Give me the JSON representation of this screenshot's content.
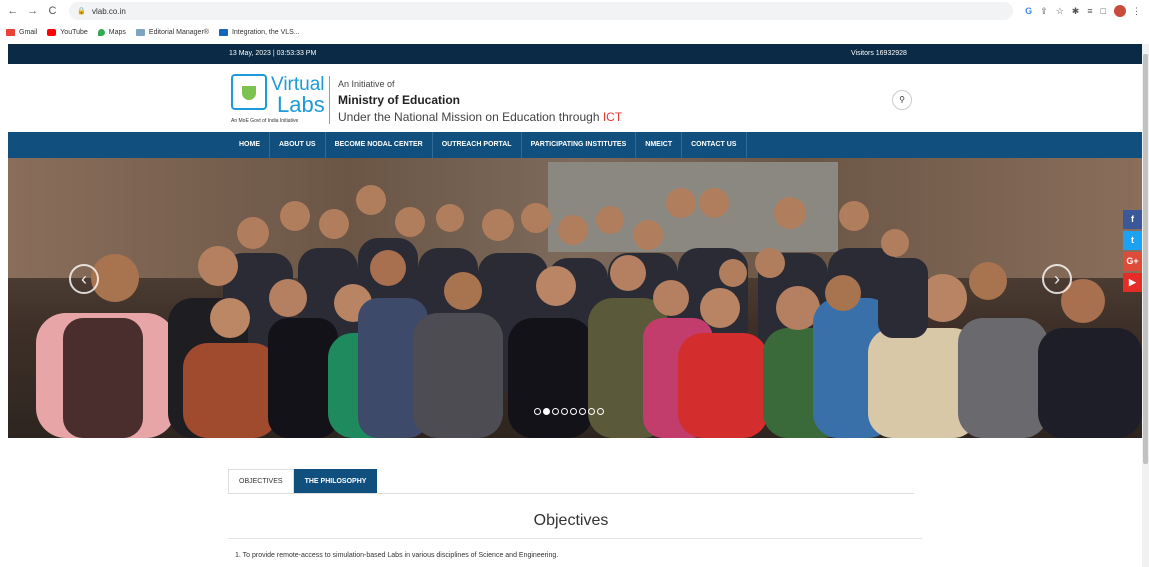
{
  "browser": {
    "back": "←",
    "forward": "→",
    "reload": "C",
    "url": "vlab.co.in",
    "extensions": [
      "G",
      "⇪",
      "☆",
      "✱",
      "≡",
      "□"
    ],
    "menu": "⋮"
  },
  "bookmarks": [
    {
      "label": "Gmail",
      "color": "#ea4335"
    },
    {
      "label": "YouTube",
      "color": "#ff0000"
    },
    {
      "label": "Maps",
      "color": "#34a853"
    },
    {
      "label": "Editorial Manager®",
      "color": "#7aa6c2"
    },
    {
      "label": "Integration, the VLS...",
      "color": "#1565c0"
    }
  ],
  "topbar": {
    "datetime": "13 May, 2023 | 03:53:33 PM",
    "visitors": "Visitors 16932928"
  },
  "header": {
    "logo_virtual": "Virtual",
    "logo_labs": "Labs",
    "logo_tagline": "An MoE Govt of India Initiative",
    "initiative": "An Initiative of",
    "ministry": "Ministry of Education",
    "mission_prefix": "Under the National Mission on Education through ",
    "mission_highlight": "ICT",
    "search_icon": "🔍"
  },
  "nav": [
    "HOME",
    "ABOUT US",
    "BECOME NODAL CENTER",
    "OUTREACH PORTAL",
    "PARTICIPATING INSTITUTES",
    "NMEICT",
    "CONTACT US"
  ],
  "carousel": {
    "prev": "‹",
    "next": "›",
    "slide_count": 8,
    "active_index": 1
  },
  "social": [
    {
      "label": "f",
      "color": "#3b5998"
    },
    {
      "label": "t",
      "color": "#1da1f2"
    },
    {
      "label": "G+",
      "color": "#dd4b39"
    },
    {
      "label": "▶",
      "color": "#e52d27"
    }
  ],
  "tabs": [
    "OBJECTIVES",
    "THE PHILOSOPHY"
  ],
  "active_tab": "THE PHILOSOPHY",
  "objectives": {
    "title": "Objectives",
    "items": [
      "1. To provide remote-access to simulation-based Labs in various disciplines of Science and Engineering."
    ]
  }
}
